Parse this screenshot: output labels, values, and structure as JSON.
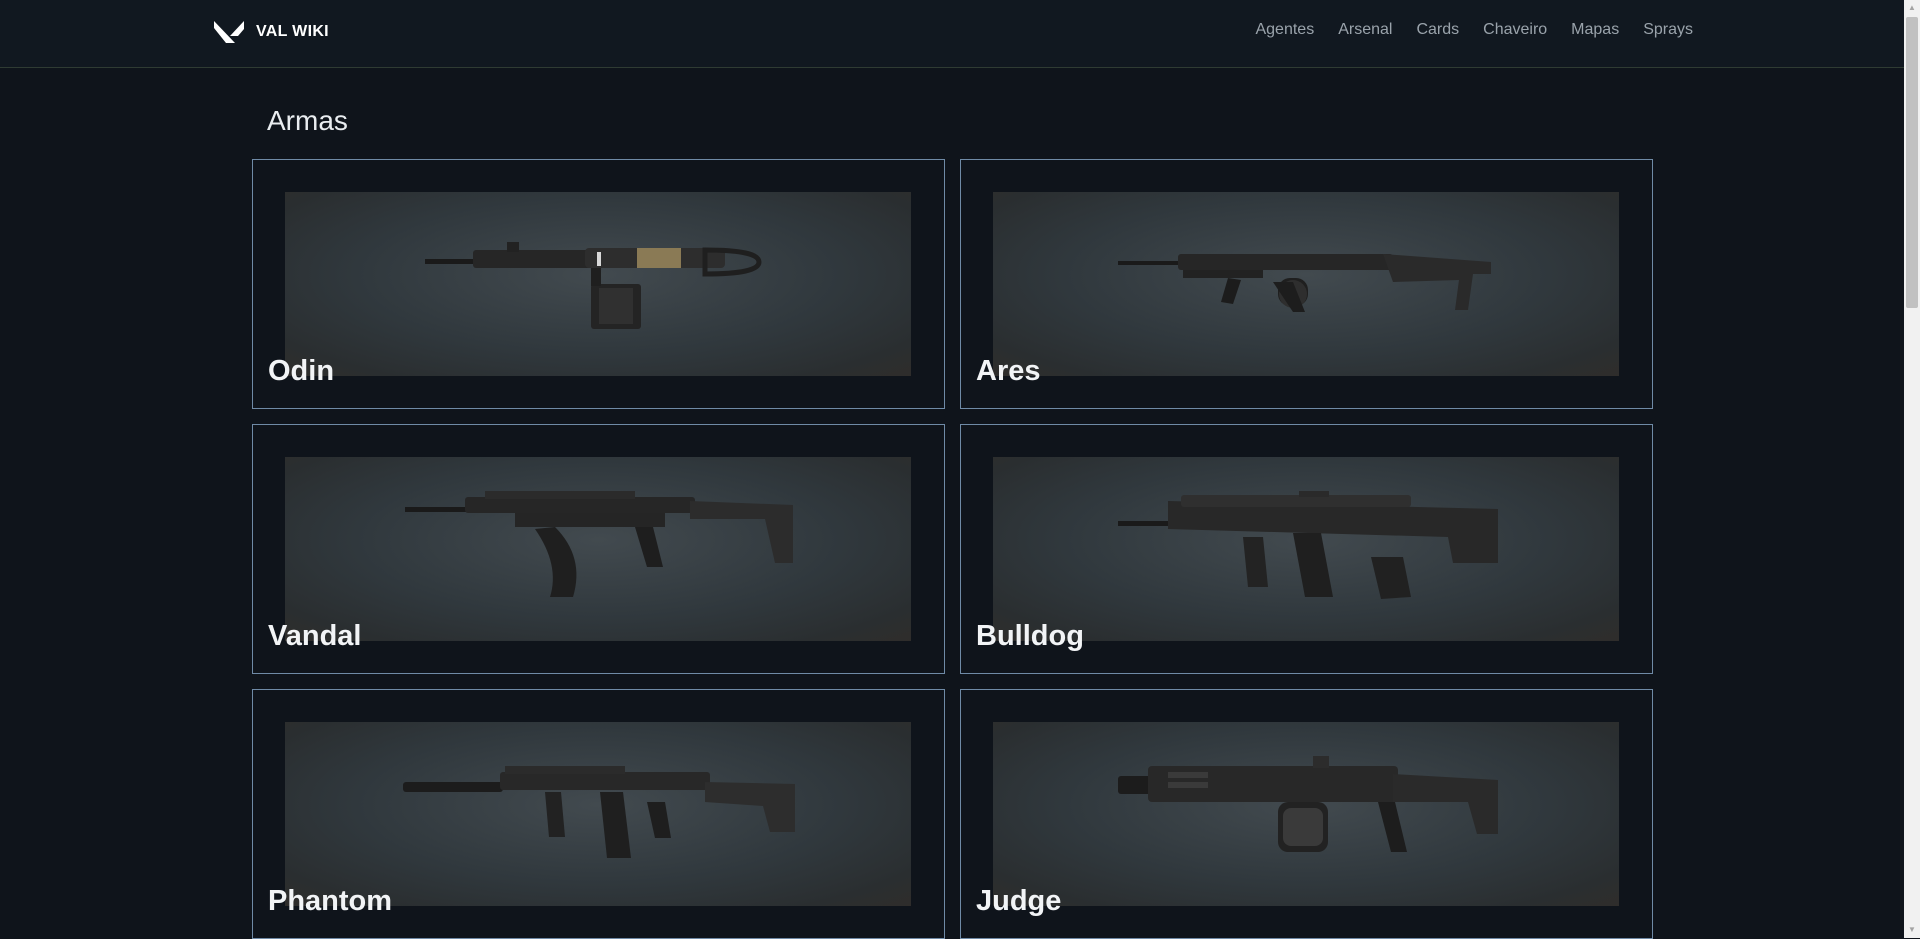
{
  "brand": {
    "name": "VAL WIKI"
  },
  "nav": {
    "items": [
      {
        "label": "Agentes"
      },
      {
        "label": "Arsenal"
      },
      {
        "label": "Cards"
      },
      {
        "label": "Chaveiro"
      },
      {
        "label": "Mapas"
      },
      {
        "label": "Sprays"
      }
    ]
  },
  "page": {
    "title": "Armas"
  },
  "weapons": [
    {
      "name": "Odin",
      "icon": "machine-gun-image"
    },
    {
      "name": "Ares",
      "icon": "machine-gun-image"
    },
    {
      "name": "Vandal",
      "icon": "rifle-image"
    },
    {
      "name": "Bulldog",
      "icon": "rifle-image"
    },
    {
      "name": "Phantom",
      "icon": "rifle-image"
    },
    {
      "name": "Judge",
      "icon": "shotgun-image"
    }
  ],
  "colors": {
    "background": "#0f141b",
    "card_border": "#6f8aa6",
    "nav_text": "#9aa3ab"
  }
}
